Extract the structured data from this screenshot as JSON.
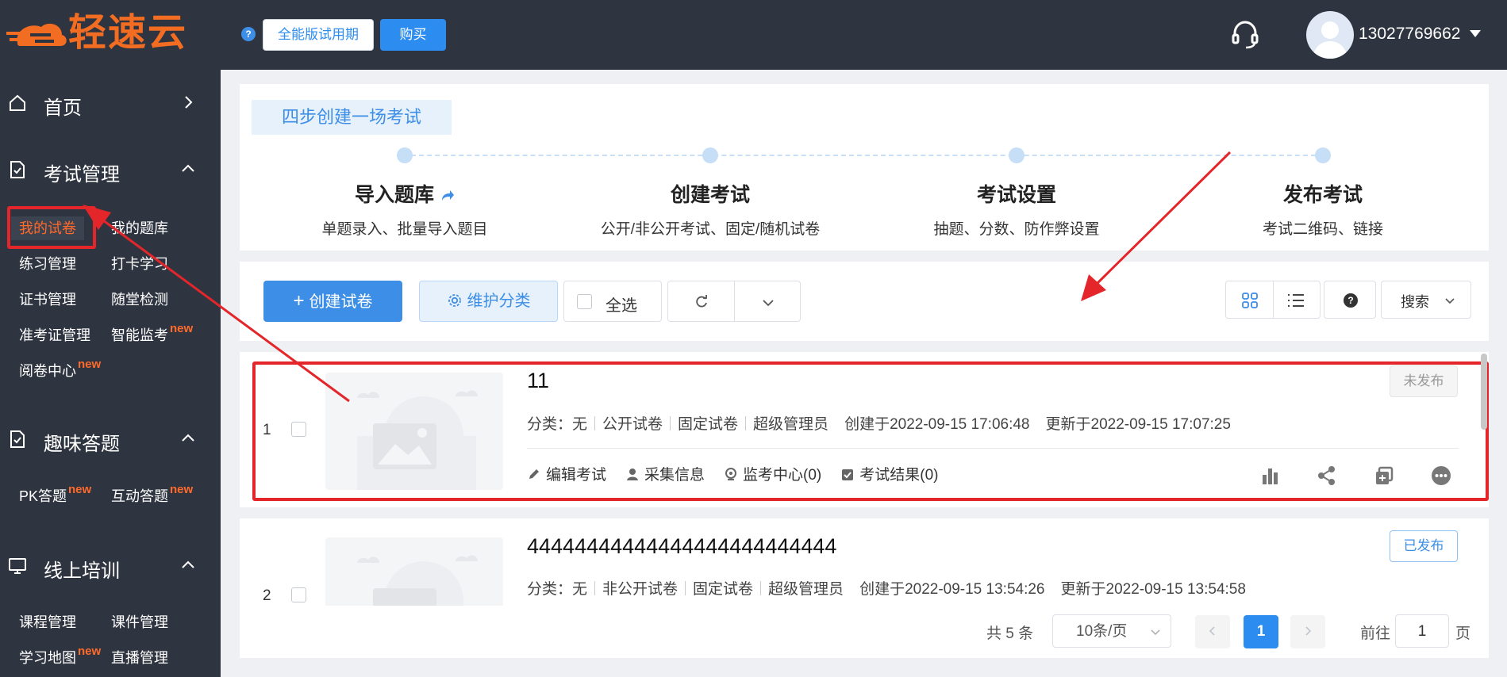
{
  "header": {
    "logo_text": "轻速云",
    "trial_label": "全能版试用期",
    "buy_label": "购买",
    "user_phone": "13027769662"
  },
  "sidebar": {
    "home": "首页",
    "exam_mgmt": {
      "title": "考试管理",
      "items": [
        "我的试卷",
        "我的题库",
        "练习管理",
        "打卡学习",
        "证书管理",
        "随堂检测",
        "准考证管理",
        "智能监考",
        "阅卷中心"
      ]
    },
    "fun_quiz": {
      "title": "趣味答题",
      "items": [
        "PK答题",
        "互动答题"
      ]
    },
    "training": {
      "title": "线上培训",
      "items": [
        "课程管理",
        "课件管理",
        "学习地图",
        "直播管理"
      ]
    },
    "new_badge": "new"
  },
  "steps": {
    "title": "四步创建一场考试",
    "items": [
      {
        "title": "导入题库",
        "desc": "单题录入、批量导入题目"
      },
      {
        "title": "创建考试",
        "desc": "公开/非公开考试、固定/随机试卷"
      },
      {
        "title": "考试设置",
        "desc": "抽题、分数、防作弊设置"
      },
      {
        "title": "发布考试",
        "desc": "考试二维码、链接"
      }
    ]
  },
  "toolbar": {
    "create_label": "创建试卷",
    "maintain_label": "维护分类",
    "select_all_label": "全选",
    "search_label": "搜索"
  },
  "exams": [
    {
      "index": "1",
      "title": "11",
      "category": "分类：无",
      "visibility": "公开试卷",
      "paper_type": "固定试卷",
      "owner": "超级管理员",
      "created": "创建于2022-09-15 17:06:48",
      "updated": "更新于2022-09-15 17:07:25",
      "status": "未发布",
      "actions": [
        "编辑考试",
        "采集信息",
        "监考中心(0)",
        "考试结果(0)"
      ]
    },
    {
      "index": "2",
      "title": "44444444444444444444444444",
      "category": "分类：无",
      "visibility": "非公开试卷",
      "paper_type": "固定试卷",
      "owner": "超级管理员",
      "created": "创建于2022-09-15 13:54:26",
      "updated": "更新于2022-09-15 13:54:58",
      "status": "已发布"
    }
  ],
  "pagination": {
    "total": "共 5 条",
    "page_size": "10条/页",
    "current": "1",
    "goto_prefix": "前往",
    "goto_value": "1",
    "goto_suffix": "页"
  },
  "colors": {
    "accent": "#3d8ee6",
    "sidebar_bg": "#2f3540",
    "highlight": "#ff6a2b",
    "annotation": "#e4262a"
  }
}
